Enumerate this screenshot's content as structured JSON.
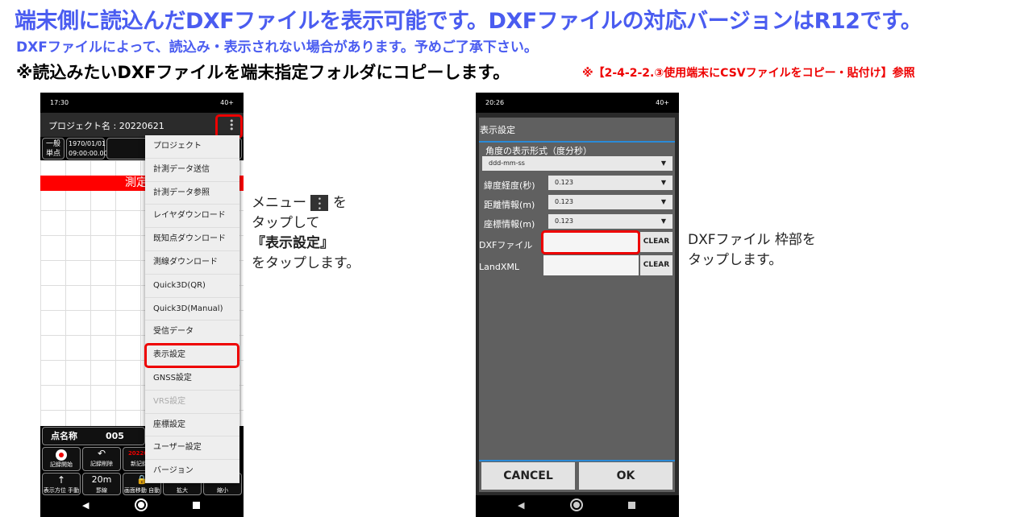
{
  "heading": {
    "line1": "端末側に読込んだDXFファイルを表示可能です。DXFファイルの対応バージョンはR12です。",
    "line2": "DXFファイルによって、読込み・表示されない場合があります。予めご了承下さい。",
    "line3": "※読込みたいDXFファイルを端末指定フォルダにコピーします。",
    "reference": "※【2-4-2-2.③使用端末にCSVファイルをコピー・貼付け】参照"
  },
  "phone1": {
    "time": "17:30",
    "status_right": "40+",
    "title": "プロジェクト名 : 20220621",
    "mode": [
      "一般",
      "単点"
    ],
    "datetime": [
      "1970/01/01",
      "09:00:00.00"
    ],
    "banner": "測定不",
    "point_label": "点名称",
    "point_value": "005",
    "menu": [
      "プロジェクト",
      "計測データ送信",
      "計測データ参照",
      "レイヤダウンロード",
      "既知点ダウンロード",
      "測線ダウンロード",
      "Quick3D(QR)",
      "Quick3D(Manual)",
      "受信データ",
      "表示設定",
      "GNSS設定",
      "VRS設定",
      "座標設定",
      "ユーザー設定",
      "バージョン"
    ],
    "buttons_row1": [
      "記録開始",
      "記録削除",
      "新記録フ"
    ],
    "file_label": "2022062",
    "buttons_row2": [
      {
        "top": "↑",
        "label": "表示方位 手動"
      },
      {
        "top": "20m",
        "label": "罫線"
      },
      {
        "top": "",
        "label": "画面移動 自動"
      },
      {
        "top": "",
        "label": "拡大"
      },
      {
        "top": "",
        "label": "縮小"
      }
    ]
  },
  "note1": {
    "line1": "メニュー",
    "line1b": "を",
    "line2": "タップして",
    "line3": "『表示設定』",
    "line4": "をタップします。"
  },
  "phone2": {
    "time": "20:26",
    "status_right": "40+",
    "dialog_title": "表示設定",
    "angle_label": "角度の表示形式（度分秒）",
    "angle_value": "ddd-mm-ss",
    "rows": [
      {
        "label": "緯度経度(秒)",
        "value": "0.123"
      },
      {
        "label": "距離情報(m)",
        "value": "0.123"
      },
      {
        "label": "座標情報(m)",
        "value": "0.123"
      }
    ],
    "dxf_label": "DXFファイル",
    "dxf_value": "",
    "landxml_label": "LandXML",
    "landxml_value": "",
    "clear": "CLEAR",
    "cancel": "CANCEL",
    "ok": "OK"
  },
  "note2": {
    "line1": "DXFファイル 枠部を",
    "line2": "タップします。"
  },
  "colors": {
    "heading": "#4a5cf0",
    "highlight": "#e00000",
    "dialog": "#606060",
    "accent_line": "#2a8ad8"
  }
}
